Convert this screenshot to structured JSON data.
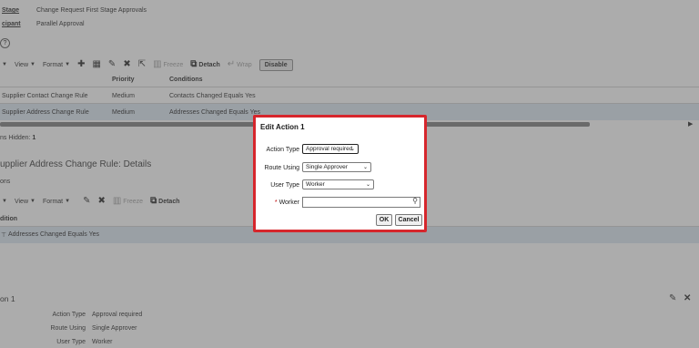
{
  "header": {
    "stage_label": "Stage",
    "stage_value": "Change Request First Stage Approvals",
    "participant_label": "cipant",
    "participant_value": "Parallel Approval",
    "help_glyph": "?"
  },
  "toolbar1": {
    "view": "View",
    "format": "Format",
    "freeze": "Freeze",
    "detach": "Detach",
    "wrap": "Wrap",
    "disable": "Disable"
  },
  "rules_table": {
    "columns": [
      "Priority",
      "Conditions"
    ],
    "rows": [
      {
        "name": "Supplier Contact Change Rule",
        "priority": "Medium",
        "conditions": "Contacts Changed Equals Yes"
      },
      {
        "name": "Supplier Address Change Rule",
        "priority": "Medium",
        "conditions": "Addresses Changed Equals Yes"
      }
    ],
    "hidden_label": "ns Hidden:",
    "hidden_count": "1"
  },
  "details": {
    "title": "upplier Address Change Rule: Details",
    "section_label": "ons"
  },
  "toolbar2": {
    "view": "View",
    "format": "Format",
    "freeze": "Freeze",
    "detach": "Detach"
  },
  "conditions_table": {
    "header": "dition",
    "row": "Addresses Changed Equals Yes"
  },
  "action_section": {
    "title": "on 1",
    "fields": [
      {
        "label": "Action Type",
        "value": "Approval required"
      },
      {
        "label": "Route Using",
        "value": "Single Approver"
      },
      {
        "label": "User Type",
        "value": "Worker"
      }
    ]
  },
  "dialog": {
    "title": "Edit Action 1",
    "action_type_label": "Action Type",
    "action_type_value": "Approval required",
    "route_using_label": "Route Using",
    "route_using_value": "Single Approver",
    "user_type_label": "User Type",
    "user_type_value": "Worker",
    "worker_required": "*",
    "worker_label": "Worker",
    "worker_value": "",
    "ok_label": "OK",
    "cancel_label": "Cancel"
  },
  "colors": {
    "dialog_border": "#d6262c",
    "selected_row": "#dbe6f1",
    "overlay": "rgba(90,90,90,0.5)"
  }
}
